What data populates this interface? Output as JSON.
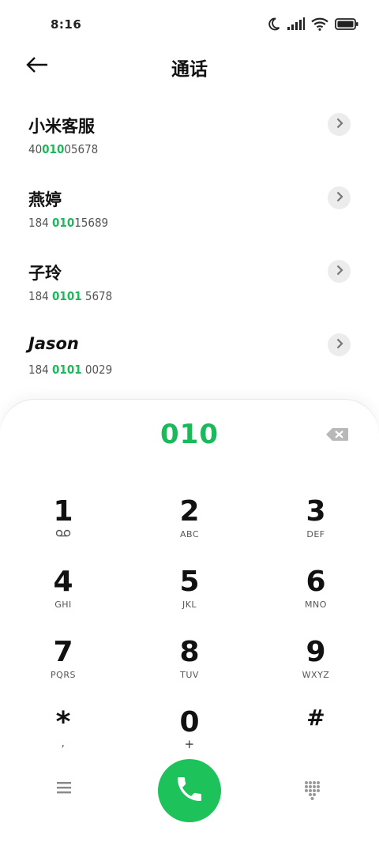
{
  "status_bar": {
    "time": "8:16"
  },
  "header": {
    "title": "通话"
  },
  "results": [
    {
      "name": "小米客服",
      "number_before": "40",
      "number_match": "010",
      "number_after": "05678"
    },
    {
      "name": "燕婷",
      "number_before": "184 ",
      "number_match": "010",
      "number_after": "15689"
    },
    {
      "name": "子玲",
      "number_before": "184 ",
      "number_match": "0101",
      "number_after": " 5678"
    },
    {
      "name": "Jason",
      "number_before": "184 ",
      "number_match": "0101",
      "number_after": " 0029"
    }
  ],
  "dialer": {
    "typed_number": "010",
    "keys": [
      {
        "digit": "1",
        "sub": ""
      },
      {
        "digit": "2",
        "sub": "ABC"
      },
      {
        "digit": "3",
        "sub": "DEF"
      },
      {
        "digit": "4",
        "sub": "GHI"
      },
      {
        "digit": "5",
        "sub": "JKL"
      },
      {
        "digit": "6",
        "sub": "MNO"
      },
      {
        "digit": "7",
        "sub": "PQRS"
      },
      {
        "digit": "8",
        "sub": "TUV"
      },
      {
        "digit": "9",
        "sub": "WXYZ"
      },
      {
        "digit": "*",
        "sub": ","
      },
      {
        "digit": "0",
        "sub": "+"
      },
      {
        "digit": "#",
        "sub": ""
      }
    ]
  },
  "colors": {
    "accent": "#1bb95a",
    "call_button": "#1ec25a"
  },
  "icons": {
    "status": [
      "moon-icon",
      "signal-icon",
      "wifi-icon",
      "battery-icon"
    ],
    "header": "back-arrow-icon",
    "result_action": "chevron-right-icon",
    "key_1_sub": "voicemail-icon",
    "dialer": [
      "backspace-icon",
      "menu-icon",
      "phone-icon",
      "dialpad-icon"
    ]
  }
}
